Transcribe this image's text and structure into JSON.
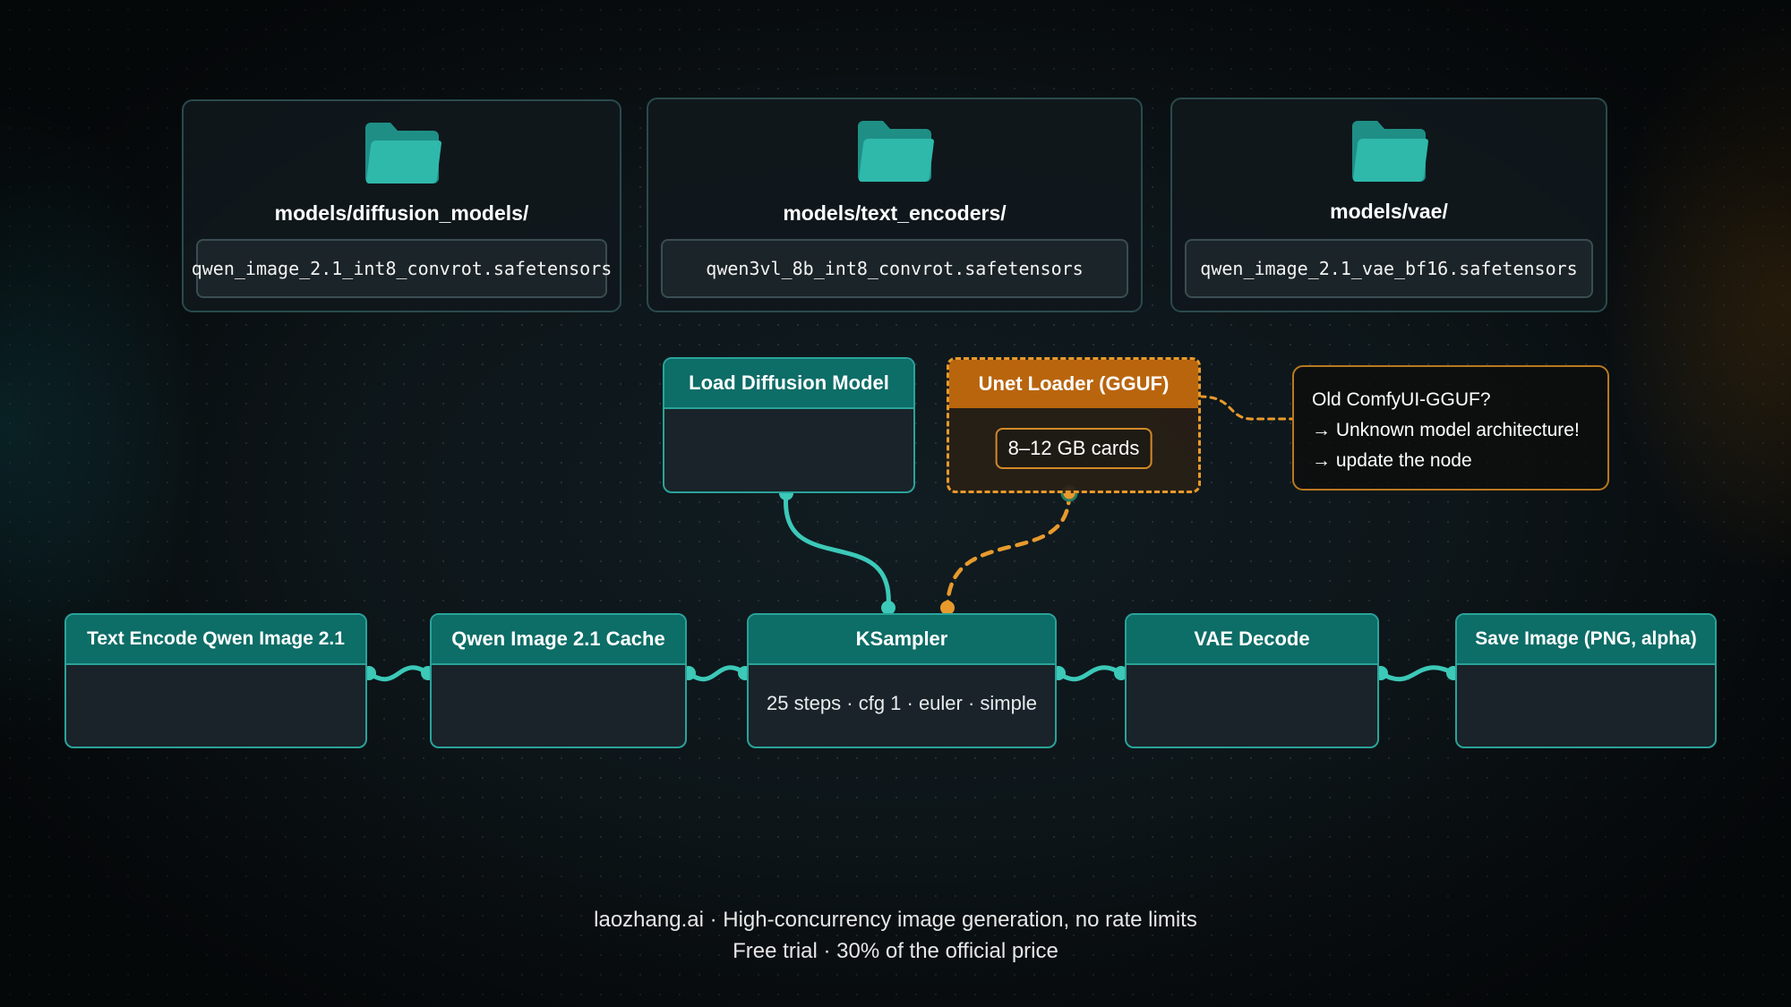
{
  "folders": [
    {
      "title": "models/diffusion_models/",
      "file": "qwen_image_2.1_int8_convrot.safetensors",
      "icon": "folder-icon"
    },
    {
      "title": "models/text_encoders/",
      "file": "qwen3vl_8b_int8_convrot.safetensors",
      "icon": "folder-icon"
    },
    {
      "title": "models/vae/",
      "file": "qwen_image_2.1_vae_bf16.safetensors",
      "icon": "folder-icon"
    }
  ],
  "loaders": {
    "load_diffusion": {
      "title": "Load Diffusion Model"
    },
    "unet_gguf": {
      "title": "Unet Loader (GGUF)",
      "badge": "8–12 GB cards"
    }
  },
  "note": {
    "lines": [
      "Old ComfyUI-GGUF?",
      "→ Unknown model architecture!",
      "→ update the node"
    ]
  },
  "pipeline": [
    {
      "title": "Text Encode Qwen Image 2.1",
      "body": ""
    },
    {
      "title": "Qwen Image 2.1 Cache",
      "body": ""
    },
    {
      "title": "KSampler",
      "body": "25 steps · cfg 1 · euler · simple"
    },
    {
      "title": "VAE Decode",
      "body": ""
    },
    {
      "title": "Save Image (PNG, alpha)",
      "body": ""
    }
  ],
  "footer": {
    "line1": "laozhang.ai · High-concurrency image generation, no rate limits",
    "line2": "Free trial · 30% of the official price"
  },
  "colors": {
    "teal_accent": "#2aa39a",
    "teal_header": "#0d6d67",
    "teal_wire": "#3cc9b8",
    "orange_accent": "#e89a2c",
    "orange_header": "#b9650e",
    "folder_teal": "#2bb3a6",
    "background": "#0b1114"
  }
}
